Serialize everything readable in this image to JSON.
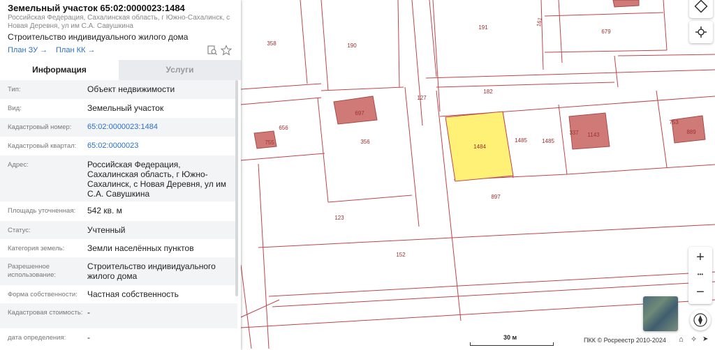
{
  "header": {
    "title": "Земельный участок 65:02:0000023:1484",
    "address": "Российская Федерация, Сахалинская область, г Южно-Сахалинск, с Новая Деревня, ул им С.А. Савушкина",
    "purpose": "Строительство индивидуального жилого дома",
    "link_plan_zu": "План ЗУ",
    "link_plan_kk": "План КК"
  },
  "tabs": {
    "info": "Информация",
    "services": "Услуги"
  },
  "info_rows": [
    {
      "label": "Тип:",
      "value": "Объект недвижимости"
    },
    {
      "label": "Вид:",
      "value": "Земельный участок"
    },
    {
      "label": "Кадастровый номер:",
      "value": "65:02:0000023:1484"
    },
    {
      "label": "Кадастровый квартал:",
      "value": "65:02:0000023"
    },
    {
      "label": "Адрес:",
      "value": "Российская Федерация, Сахалинская область, г Южно-Сахалинск, с Новая Деревня, ул им С.А. Савушкина"
    },
    {
      "label": "Площадь уточненная:",
      "value": "542 кв. м"
    },
    {
      "label": "Статус:",
      "value": "Учтенный"
    },
    {
      "label": "Категория земель:",
      "value": "Земли населённых пунктов"
    },
    {
      "label": "Разрешенное использование:",
      "value": "Строительство индивидуального жилого дома"
    },
    {
      "label": "Форма собственности:",
      "value": "Частная собственность"
    },
    {
      "label": "Кадастровая стоимость:",
      "value": "-"
    },
    {
      "label": "дата определения:",
      "value": "-"
    }
  ],
  "map": {
    "parcel_numbers": [
      "358",
      "190",
      "191",
      "161",
      "679",
      "182",
      "127",
      "656",
      "697",
      "356",
      "1484",
      "1485",
      "1485",
      "337",
      "1143",
      "753",
      "889",
      "755",
      "897",
      "123",
      "152"
    ],
    "scale_label": "30 м",
    "attribution": "ПКК © Росреестр 2010-2024"
  },
  "controls": {
    "zoom_in": "+",
    "zoom_more": "•••",
    "zoom_out": "−"
  },
  "colors": {
    "parcel_line": "#c0444a",
    "building_fill": "#d07a78",
    "selected_fill": "#fff176",
    "link": "#2a6fc9"
  }
}
